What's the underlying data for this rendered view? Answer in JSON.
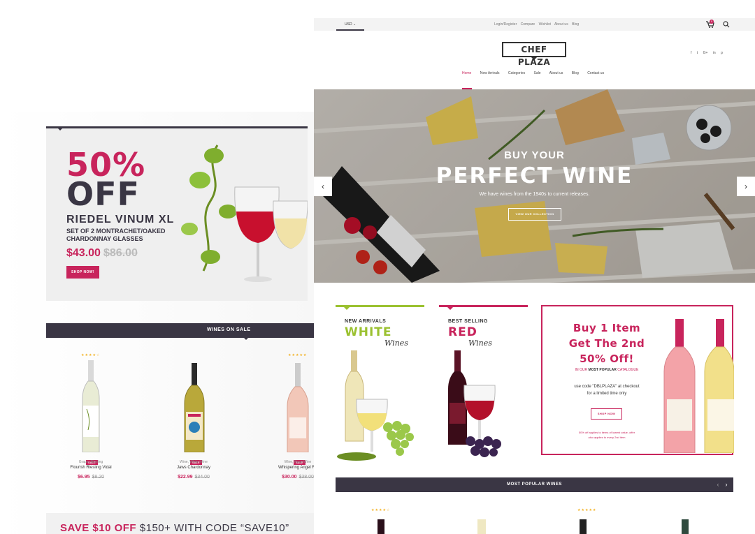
{
  "left": {
    "promo": {
      "percent": "50%",
      "off": "OFF",
      "name": "RIEDEL VINUM XL",
      "desc": "SET OF 2 MONTRACHET/OAKED CHARDONNAY GLASSES",
      "price": "$43.00",
      "old_price": "$86.00",
      "button": "SHOP NOW!"
    },
    "sale_title": "WINES ON SALE",
    "products": [
      {
        "stars": "★★★★☆",
        "badge": "SALE",
        "category": "Grape, Riesling",
        "name": "Flourish Riesling Vidal",
        "price": "$6.95",
        "old_price": "$8.20"
      },
      {
        "stars": "",
        "badge": "SALE",
        "category": "Wine, White Wine",
        "name": "Jaws Chardonnay",
        "price": "$22.99",
        "old_price": "$34.00"
      },
      {
        "stars": "★★★★★",
        "badge": "SALE",
        "category": "Wine, Rose Wine",
        "name": "Whispering Angel Ro",
        "price": "$30.00",
        "old_price": "$38.00"
      }
    ],
    "save_banner_prefix": "SAVE $10 OFF",
    "save_banner_rest": " $150+ WITH CODE “SAVE10”"
  },
  "topbar": {
    "currency": "USD",
    "links": [
      "Login/Register",
      "Compare",
      "Wishlist",
      "About us",
      "Blog"
    ],
    "cart_count": "0"
  },
  "logo": "CHEF PLAZA",
  "social": [
    "f",
    "t",
    "G+",
    "in",
    "p"
  ],
  "nav": [
    "Home",
    "New Arrivals",
    "Categories",
    "Sale",
    "About us",
    "Blog",
    "Contact us"
  ],
  "hero": {
    "kicker": "BUY YOUR",
    "title": "PERFECT WINE",
    "subtitle": "We have wines from the 1940s to current releases.",
    "button": "VIEW OUR COLLECTION",
    "prev": "‹",
    "next": "›"
  },
  "categories": [
    {
      "kicker": "NEW ARRIVALS",
      "big": "WHITE",
      "script": "Wines"
    },
    {
      "kicker": "BEST SELLING",
      "big": "RED",
      "script": "Wines"
    }
  ],
  "offer": {
    "title_1": "Buy 1 Item",
    "title_2": "Get The 2nd",
    "title_3": "50% Off!",
    "catalogue_prefix": "IN OUR ",
    "catalogue_bold": "MOST POPULAR",
    "catalogue_suffix": " CATALOGUE",
    "code_1": "use code \"DBLPLAZA\" at checkout",
    "code_2": "for a limited time only",
    "button": "SHOP NOW",
    "note_1": "50% off applies to items of lowest value, offer",
    "note_2": "also applies to every 2nd item"
  },
  "popular": {
    "title": "MOST POPULAR WINES",
    "prev": "‹",
    "next": "›",
    "stars": [
      "★★★★☆",
      "★★★★★"
    ]
  },
  "colors": {
    "accent": "#c8245c",
    "dark": "#3a3644",
    "green": "#9bc130",
    "star": "#f2b01e"
  }
}
